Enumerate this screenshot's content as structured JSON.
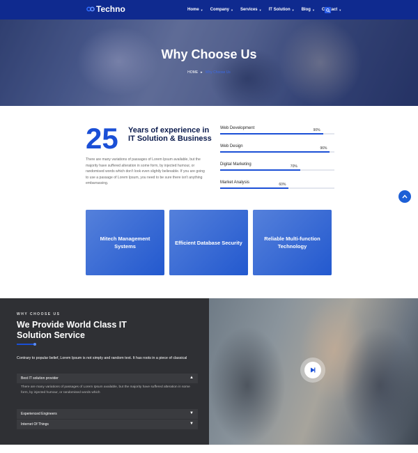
{
  "header": {
    "logo": "Techno",
    "nav": [
      {
        "label": "Home"
      },
      {
        "label": "Company"
      },
      {
        "label": "Services"
      },
      {
        "label": "IT Solution"
      },
      {
        "label": "Blog"
      },
      {
        "label": "Contact"
      }
    ]
  },
  "hero": {
    "title": "Why Choose Us",
    "breadcrumb_home": "HOME",
    "breadcrumb_current": "Why Choose Us"
  },
  "experience": {
    "number": "25",
    "title": "Years of experience in IT Solution & Business",
    "text": "There are many variations of passages of Lorem Ipsum available, but the majority have suffered alteration in some form, by injected humour, or randomised words which don't look even slightly believable. If you are going to use a passage of Lorem Ipsum, you need to be sure there isn't anything embarrassing."
  },
  "skills": [
    {
      "label": "Web Development",
      "value": 90,
      "pct": "90%"
    },
    {
      "label": "Web Design",
      "value": 96,
      "pct": "96%"
    },
    {
      "label": "Digital Marketing",
      "value": 70,
      "pct": "70%"
    },
    {
      "label": "Market Analysis",
      "value": 60,
      "pct": "60%"
    }
  ],
  "cards": [
    {
      "label": "Mitech Management Systems"
    },
    {
      "label": "Efficient Database Security"
    },
    {
      "label": "Reliable Multi-function Technology"
    }
  ],
  "why": {
    "label": "WHY CHOOSE US",
    "title": "We Provide World Class IT Solution Service",
    "text": "Contrary to popular belief, Lorem Ipsum is not simply and random text. It has roots in a piece of classical",
    "accordion": [
      {
        "title": "Best IT solution provider",
        "open": true
      },
      {
        "title": "Experienced Engineers",
        "open": false
      },
      {
        "title": "Internet Of Things",
        "open": false
      }
    ],
    "accordion_body": "There are many variations of passages of Lorem Ipsum available, but the majority have suffered alteration in some form, by injected humour, or randomised words which"
  },
  "colors": {
    "header_bg": "#0f2a8f",
    "accent": "#1a4fd6",
    "dark_section": "#2f3034"
  },
  "icons": {
    "search": "search-icon",
    "scroll_top": "chevron-up-icon",
    "play": "play-icon"
  }
}
